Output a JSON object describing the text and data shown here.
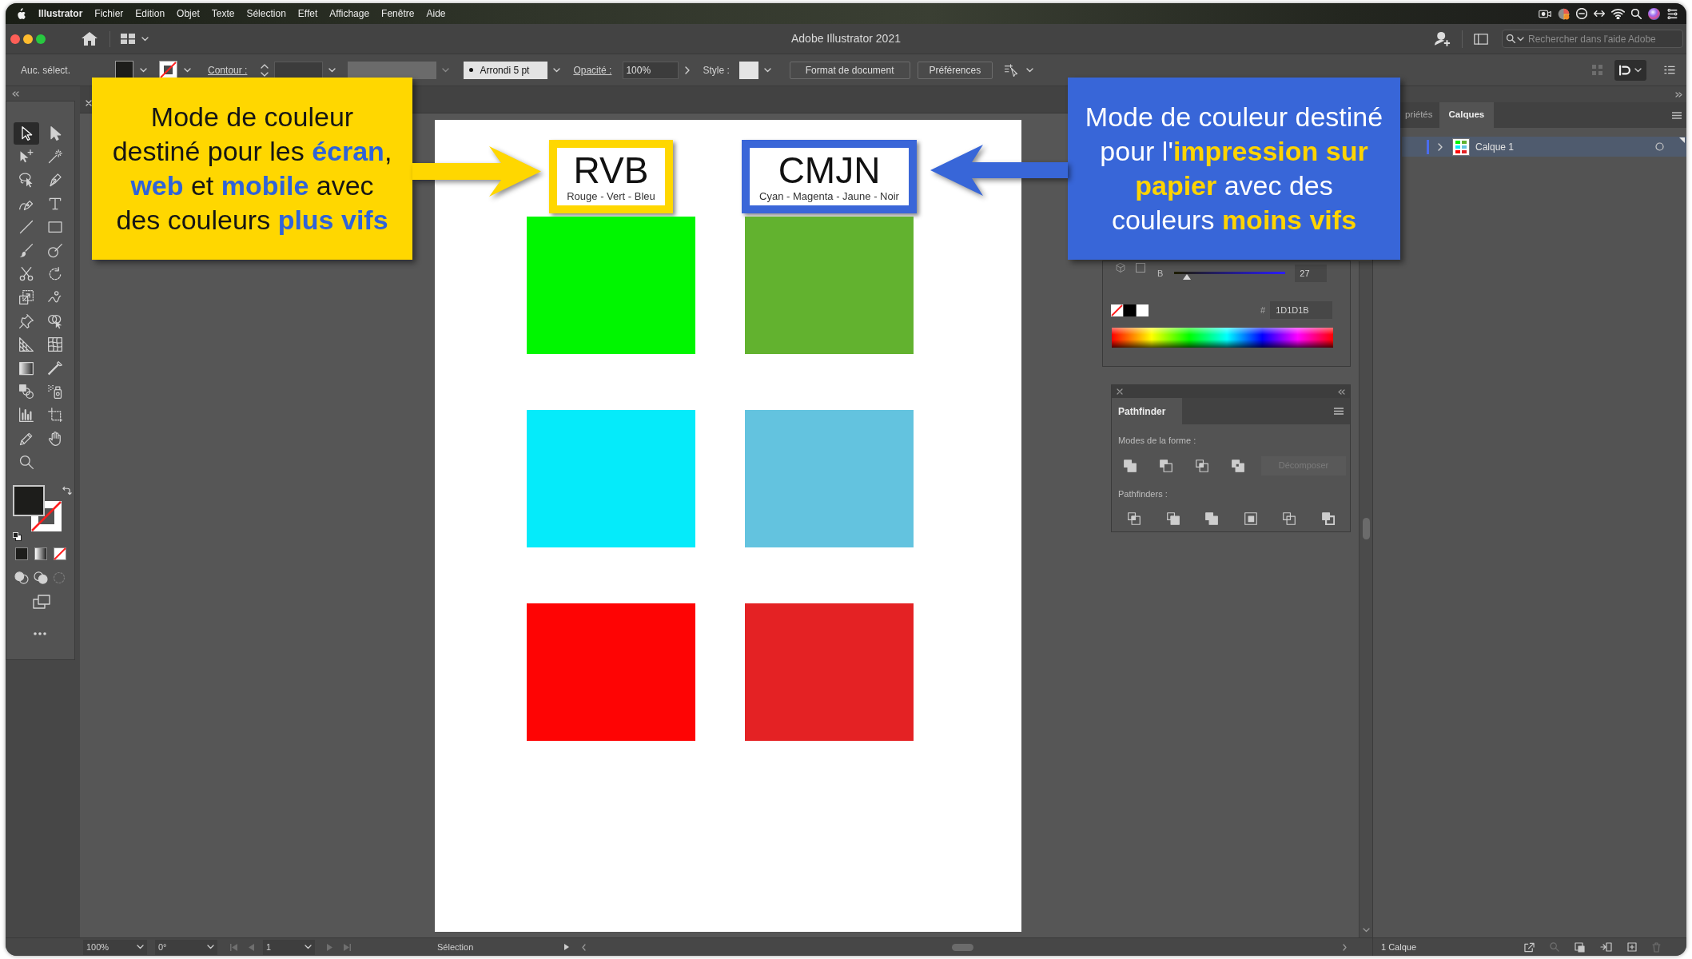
{
  "menu_bar": {
    "app": "Illustrator",
    "items": [
      "Fichier",
      "Edition",
      "Objet",
      "Texte",
      "Sélection",
      "Effet",
      "Affichage",
      "Fenêtre",
      "Aide"
    ]
  },
  "title_bar": {
    "title": "Adobe Illustrator 2021",
    "search": {
      "placeholder": "Rechercher dans l'aide Adobe"
    }
  },
  "control_bar": {
    "selection": "Auc. sélect.",
    "stroke_label": "Contour :",
    "brush": "Arrondi 5 pt",
    "opacity_label": "Opacité :",
    "opacity": "100%",
    "style_label": "Style :",
    "buttons": [
      "Format de document",
      "Préférences"
    ]
  },
  "toolbar": {
    "tools": [
      {
        "selected": true
      },
      {
        "selected": false
      },
      {
        "selected": false
      },
      {
        "selected": false
      },
      {
        "selected": false
      },
      {
        "selected": false
      },
      {
        "selected": false
      },
      {
        "selected": false
      },
      {
        "selected": false
      },
      {
        "selected": false
      },
      {
        "selected": false
      },
      {
        "selected": false
      },
      {
        "selected": false
      },
      {
        "selected": false
      },
      {
        "selected": false
      },
      {
        "selected": false
      },
      {
        "selected": false
      },
      {
        "selected": false
      },
      {
        "selected": false
      },
      {
        "selected": false
      },
      {
        "selected": false
      },
      {
        "selected": false
      },
      {
        "selected": false
      },
      {
        "selected": false
      },
      {
        "selected": false
      },
      {
        "selected": false
      },
      {
        "selected": false
      },
      {
        "selected": false
      },
      {
        "selected": false
      }
    ]
  },
  "artboard": {
    "columns": [
      {
        "kind": "rgb",
        "title": "RVB",
        "subtitle": "Rouge - Vert - Bleu",
        "swatches": [
          {
            "color": "#00f600"
          },
          {
            "color": "#05ebfa"
          },
          {
            "color": "#fe0404"
          }
        ]
      },
      {
        "kind": "cmyk",
        "title": "CMJN",
        "subtitle": "Cyan - Magenta - Jaune - Noir",
        "swatches": [
          {
            "color": "#62b22f"
          },
          {
            "color": "#63c3df"
          },
          {
            "color": "#e42224"
          }
        ]
      }
    ]
  },
  "callouts": [
    {
      "kind": "rgb",
      "text": "Mode de couleur\ndestiné pour les **écran**,\n**web** et **mobile** avec\ndes couleurs **plus vifs**"
    },
    {
      "kind": "cmyk",
      "text": "Mode de couleur destiné\npour l'**impression sur**\n**papier** avec des\ncouleurs **moins vifs**"
    }
  ],
  "color_panel": {
    "channel": {
      "label": "B",
      "level": 0.11,
      "reading": "27"
    },
    "hex_label": "#",
    "hex": "1D1D1B"
  },
  "pathfinder_panel": {
    "title": "Pathfinder",
    "shape_modes_label": "Modes de la forme :",
    "expand_button": {
      "label": "Décomposer",
      "disabled": true
    },
    "pathfinders_label": "Pathfinders :"
  },
  "layers_panel": {
    "tabs": [
      {
        "label": "priétés",
        "selected": false
      },
      {
        "label": "Calques",
        "selected": true
      }
    ],
    "layers": [
      {
        "name": "Calque 1",
        "selected": true,
        "expanded": false
      }
    ],
    "footer": "1 Calque"
  },
  "status_bar": {
    "zoom": "100%",
    "rotation": "0°",
    "artboard": "1",
    "tool": "Sélection"
  }
}
